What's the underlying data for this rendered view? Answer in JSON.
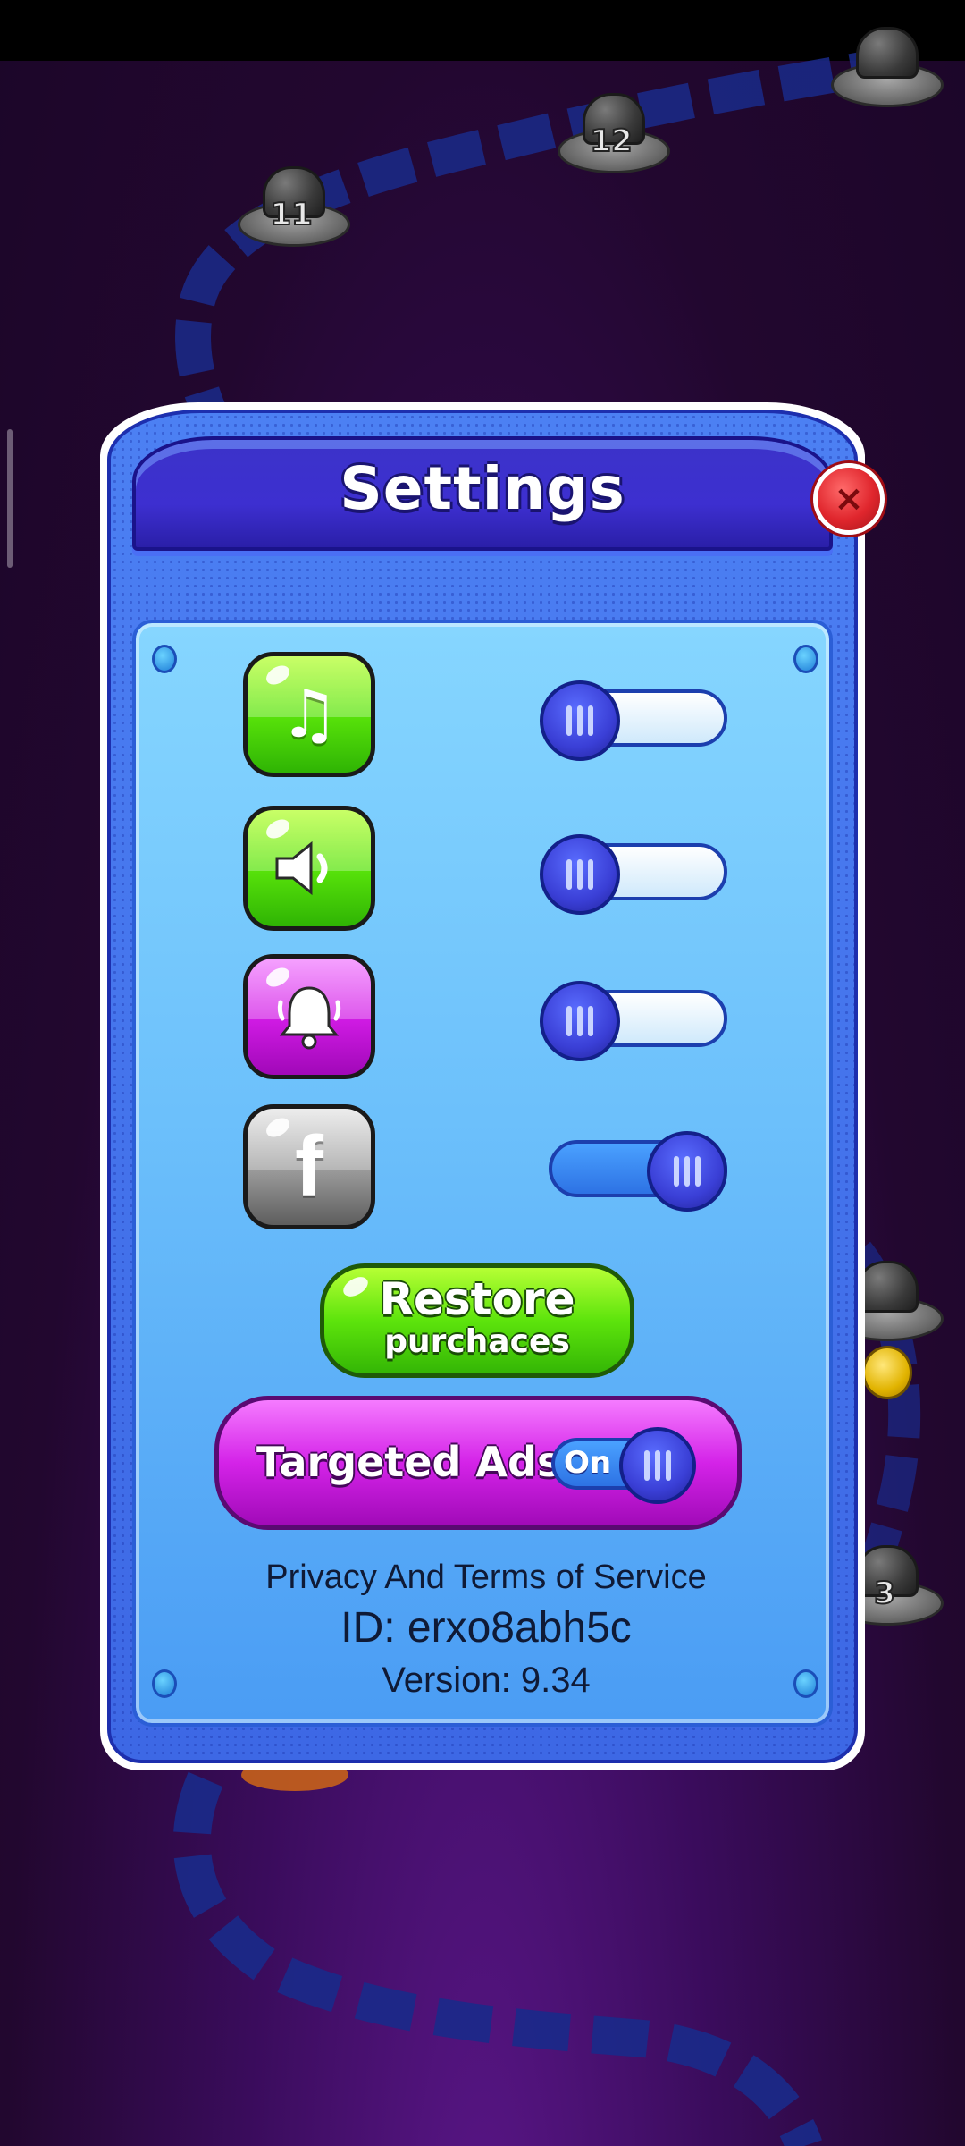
{
  "map": {
    "levels": [
      "11",
      "12",
      "3"
    ]
  },
  "settings": {
    "title": "Settings",
    "close_icon": "×",
    "rows": [
      {
        "name": "music",
        "icon": "♫",
        "color": "#59e40a",
        "toggle": "off"
      },
      {
        "name": "sound",
        "icon": "◀)",
        "color": "#59e40a",
        "toggle": "off"
      },
      {
        "name": "notifications",
        "icon": "bell",
        "color": "#d21ce6",
        "toggle": "off"
      },
      {
        "name": "facebook",
        "icon": "f",
        "color": "#9e9e9e",
        "toggle": "on"
      }
    ],
    "restore": {
      "line1": "Restore",
      "line2": "purchaces"
    },
    "ads": {
      "label": "Targeted Ads",
      "state": "On"
    },
    "privacy_link": "Privacy And  Terms of Service",
    "id_text": "ID: erxo8abh5c",
    "version_text": "Version: 9.34"
  }
}
